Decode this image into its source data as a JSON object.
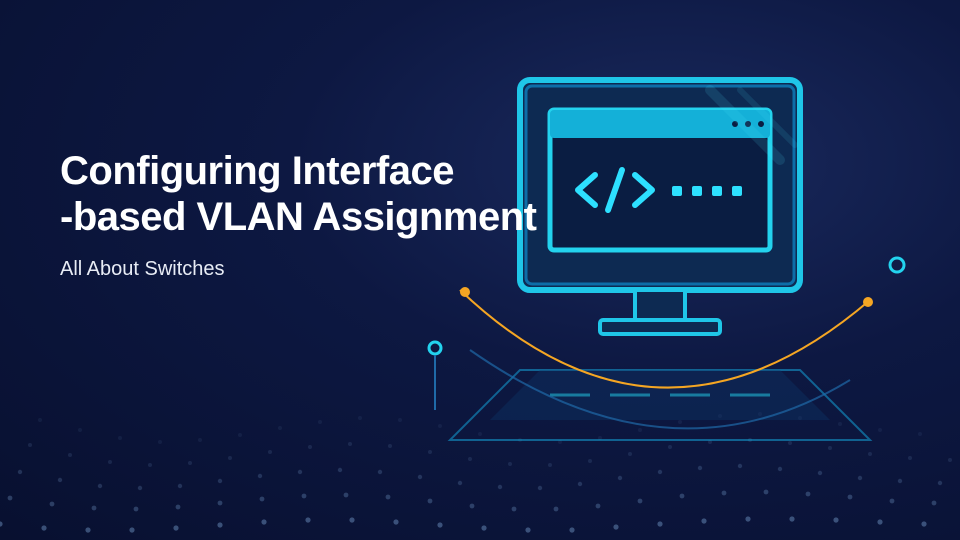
{
  "title_line1": "Configuring Interface",
  "title_line2": "-based VLAN Assignment",
  "subtitle": "All About Switches",
  "code_symbol": "</>",
  "colors": {
    "accent_cyan": "#23d3ee",
    "accent_cyan_dark": "#0d6ea8",
    "accent_orange": "#f5a623",
    "bg_deep": "#081030"
  }
}
